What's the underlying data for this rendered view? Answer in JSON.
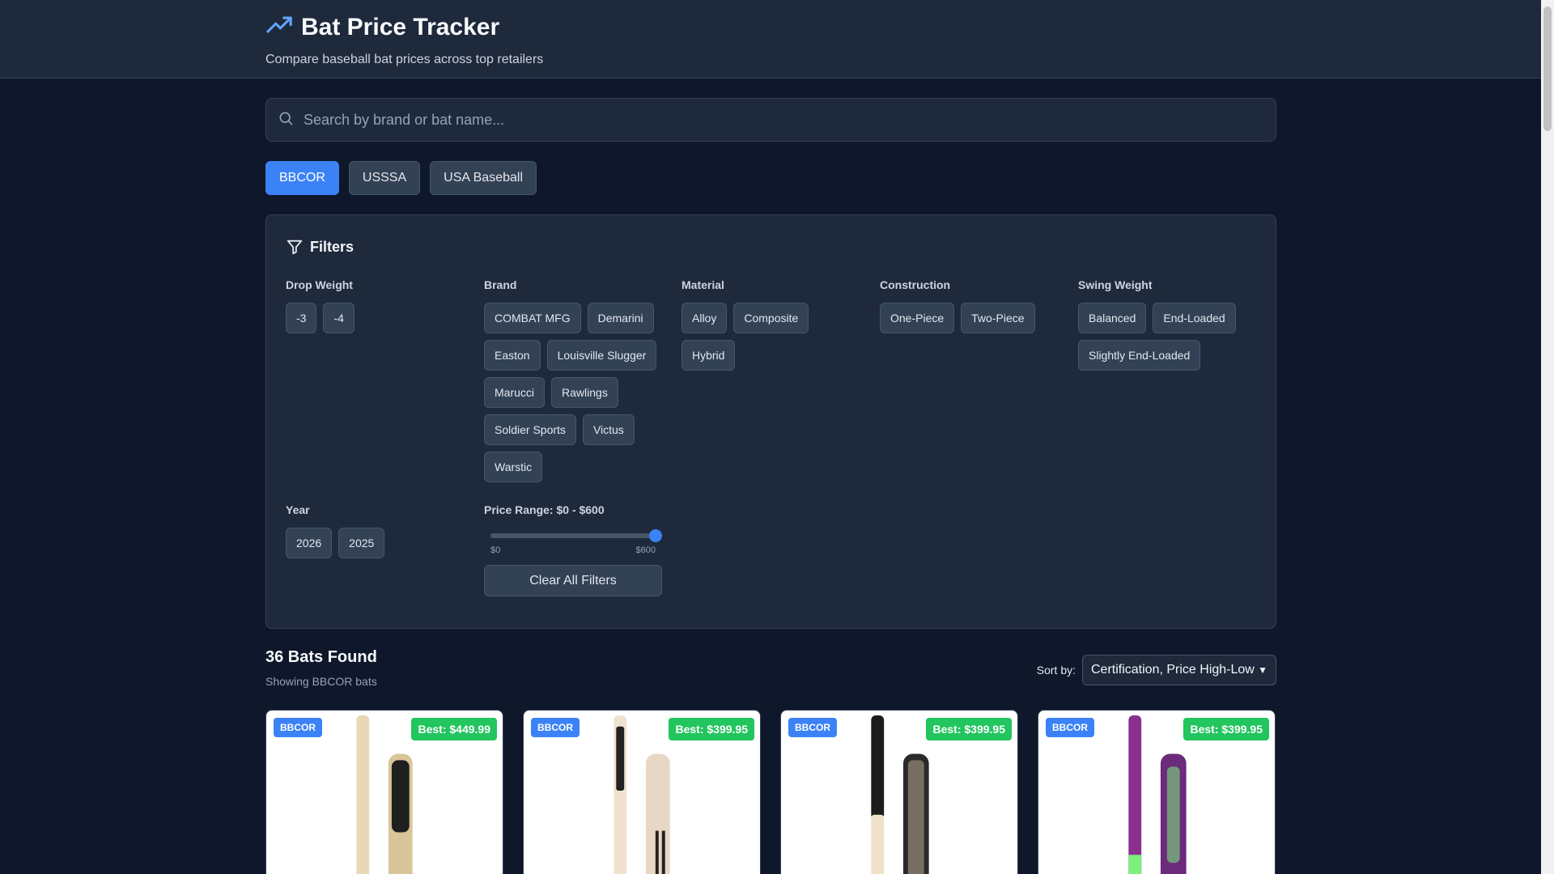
{
  "header": {
    "title": "Bat Price Tracker",
    "subtitle": "Compare baseball bat prices across top retailers",
    "icon": "trending-up-icon",
    "accent": "#60a5fa"
  },
  "search": {
    "placeholder": "Search by brand or bat name...",
    "value": ""
  },
  "cert_tabs": [
    {
      "label": "BBCOR",
      "active": true
    },
    {
      "label": "USSSA",
      "active": false
    },
    {
      "label": "USA Baseball",
      "active": false
    }
  ],
  "filters": {
    "title": "Filters",
    "drop_weight": {
      "label": "Drop Weight",
      "options": [
        "-3",
        "-4"
      ]
    },
    "brand": {
      "label": "Brand",
      "options": [
        "COMBAT MFG",
        "Demarini",
        "Easton",
        "Louisville Slugger",
        "Marucci",
        "Rawlings",
        "Soldier Sports",
        "Victus",
        "Warstic"
      ]
    },
    "material": {
      "label": "Material",
      "options": [
        "Alloy",
        "Composite",
        "Hybrid"
      ]
    },
    "construction": {
      "label": "Construction",
      "options": [
        "One-Piece",
        "Two-Piece"
      ]
    },
    "swing_weight": {
      "label": "Swing Weight",
      "options": [
        "Balanced",
        "End-Loaded",
        "Slightly End-Loaded"
      ]
    },
    "year": {
      "label": "Year",
      "options": [
        "2026",
        "2025"
      ]
    },
    "price": {
      "label": "Price Range: $0 - $600",
      "min_label": "$0",
      "max_label": "$600",
      "min": 0,
      "max": 600,
      "value": 600
    },
    "clear_label": "Clear All Filters"
  },
  "results": {
    "title": "36 Bats Found",
    "subtitle": "Showing BBCOR bats",
    "sort_label": "Sort by:",
    "sort_value": "Certification, Price High-Low"
  },
  "cards": [
    {
      "cert": "BBCOR",
      "best": "Best: $449.99",
      "bat_colors": [
        "#e8d8b5",
        "#d9c59a"
      ],
      "label_color": "#1f1f1f"
    },
    {
      "cert": "BBCOR",
      "best": "Best: $399.95",
      "bat_colors": [
        "#efe2cf",
        "#e8d7c4"
      ],
      "label_color": "#222222"
    },
    {
      "cert": "BBCOR",
      "best": "Best: $399.95",
      "bat_colors": [
        "#1c1c1c",
        "#2a2a2a"
      ],
      "label_color": "#e8d8b5"
    },
    {
      "cert": "BBCOR",
      "best": "Best: $399.95",
      "bat_colors": [
        "#8b2f8f",
        "#6b2a7a"
      ],
      "label_color": "#7cf07c"
    }
  ]
}
